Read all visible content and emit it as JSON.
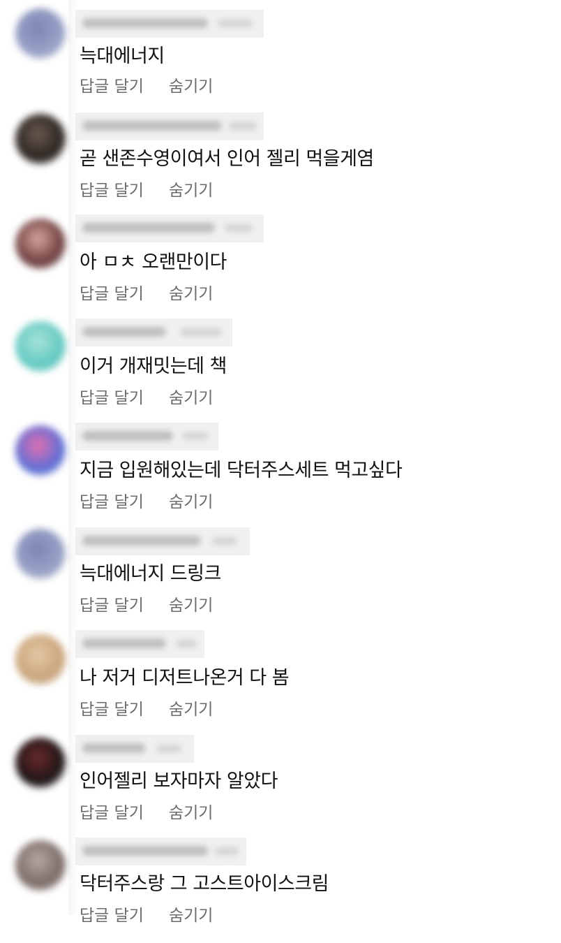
{
  "actions": {
    "reply_label": "답글 달기",
    "hide_label": "숨기기"
  },
  "comments": [
    {
      "text": "늑대에너지",
      "avatar_colors": [
        "#9aa3c7",
        "#7b86b3"
      ]
    },
    {
      "text": "곧 샌존수영이여서 인어 젤리 먹을게염",
      "avatar_colors": [
        "#2a2420",
        "#6a5a50"
      ]
    },
    {
      "text": "아 ㅁㅊ 오랜만이다",
      "avatar_colors": [
        "#6b3c3c",
        "#d9a7a0"
      ]
    },
    {
      "text": "이거 개재밋는데 책",
      "avatar_colors": [
        "#5fc8c0",
        "#a9e3d9"
      ]
    },
    {
      "text": "지금 입원해있는데 닥터주스세트 먹고싶다",
      "avatar_colors": [
        "#5b6fd6",
        "#e36fb0"
      ]
    },
    {
      "text": "늑대에너지 드링크",
      "avatar_colors": [
        "#9aa3c7",
        "#7b86b3"
      ]
    },
    {
      "text": "나 저거 디저트나온거 다 봄",
      "avatar_colors": [
        "#c9a37a",
        "#e3c9a6"
      ]
    },
    {
      "text": "인어젤리 보자마자 알았다",
      "avatar_colors": [
        "#1c1416",
        "#6a2a2a"
      ]
    },
    {
      "text": "닥터주스랑 그 고스트아이스크림",
      "avatar_colors": [
        "#7a6a66",
        "#b8a8a3"
      ]
    }
  ]
}
